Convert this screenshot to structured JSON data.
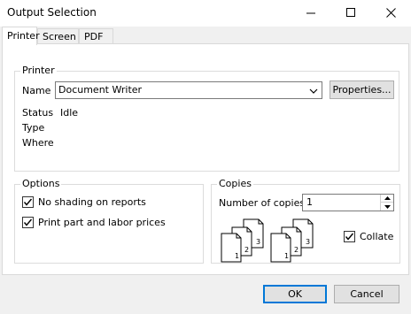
{
  "window": {
    "title": "Output Selection",
    "controls": {
      "minimize": "minimize-icon",
      "maximize": "maximize-icon",
      "close": "close-icon"
    }
  },
  "tabs": [
    {
      "label": "Printer",
      "active": true
    },
    {
      "label": "Screen",
      "active": false
    },
    {
      "label": "PDF",
      "active": false
    }
  ],
  "printer_group": {
    "legend": "Printer",
    "name_label": "Name",
    "name_value": "Document Writer",
    "properties_button": "Properties...",
    "status_label": "Status",
    "status_value": "Idle",
    "type_label": "Type",
    "type_value": "",
    "where_label": "Where",
    "where_value": ""
  },
  "options_group": {
    "legend": "Options",
    "no_shading": {
      "label": "No shading on reports",
      "checked": true
    },
    "print_prices": {
      "label": "Print part and labor prices",
      "checked": true
    }
  },
  "copies_group": {
    "legend": "Copies",
    "number_label": "Number of copies:",
    "number_value": "1",
    "collate": {
      "label": "Collate",
      "checked": true
    },
    "collate_pages": [
      "1",
      "2",
      "3"
    ]
  },
  "buttons": {
    "ok": "OK",
    "cancel": "Cancel"
  },
  "colors": {
    "accent": "#0078d7",
    "face": "#f0f0f0",
    "button": "#e1e1e1"
  }
}
